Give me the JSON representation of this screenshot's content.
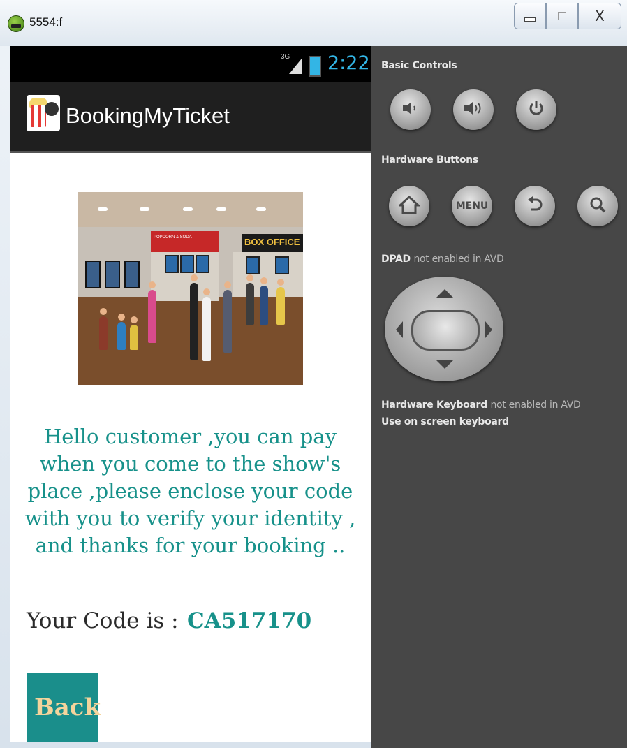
{
  "window": {
    "title": "5554:f",
    "minimize_icon": "minimize-icon",
    "maximize_icon": "maximize-icon",
    "close_glyph": "X"
  },
  "device": {
    "status_bar": {
      "network": "3G",
      "time": "2:22",
      "accent_color": "#33b5e5"
    },
    "action_bar": {
      "app_title": "BookingMyTicket",
      "app_icon": "popcorn-film-icon"
    },
    "scene_image": {
      "description": "cinema-lobby-illustration",
      "box_office_text": "BOX OFFICE",
      "popcorn_text": "POPCORN & SODA"
    },
    "message": "Hello customer ,you can pay when you come to the show's place ,please enclose your code with you to verify your identity , and thanks for your booking ..",
    "code_label": "Your Code is :",
    "code_value": "CA517170",
    "back_button": "Back",
    "accent_color": "#17918a"
  },
  "controls_panel": {
    "basic_controls_label": "Basic Controls",
    "hardware_buttons_label": "Hardware Buttons",
    "menu_label": "MENU",
    "dpad_label": "DPAD",
    "dpad_note": "not enabled in AVD",
    "keyboard_label": "Hardware Keyboard",
    "keyboard_note": "not enabled in AVD",
    "keyboard_hint": "Use on screen keyboard"
  }
}
